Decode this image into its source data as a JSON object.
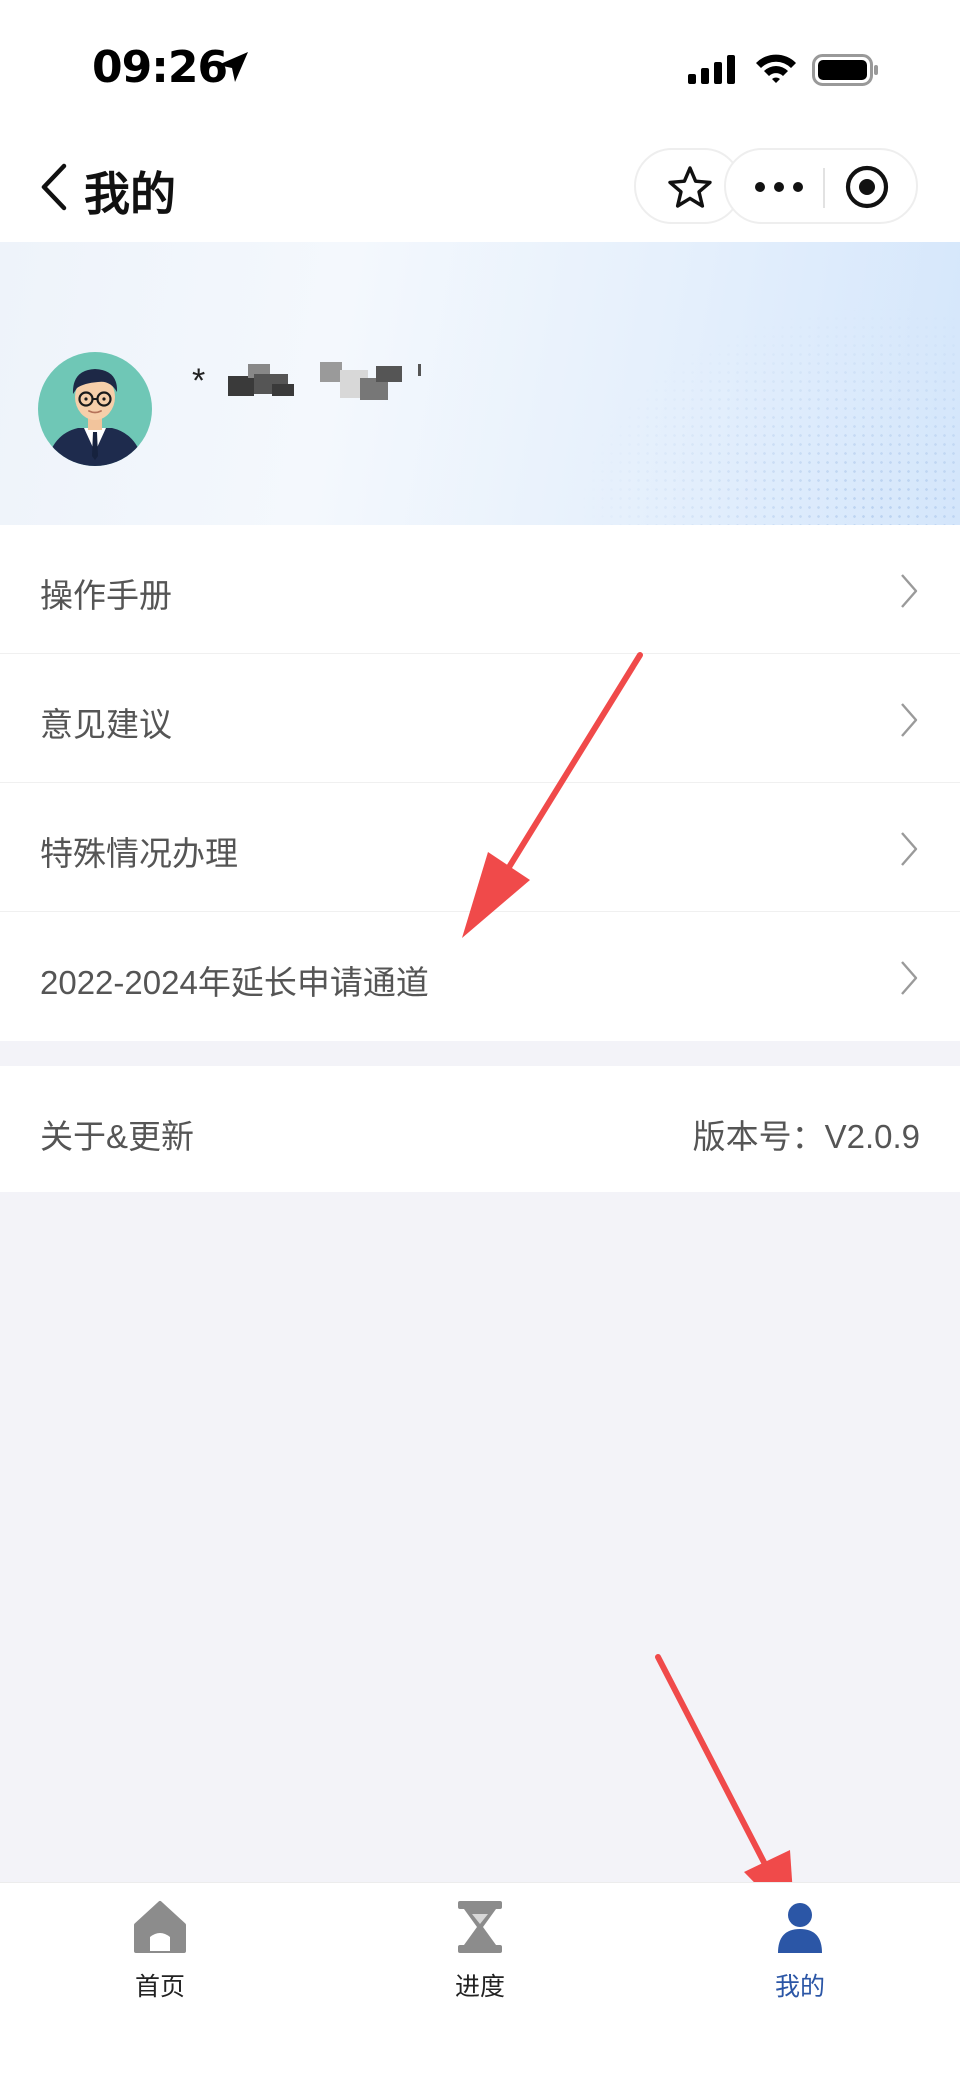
{
  "status_bar": {
    "time": "09:26"
  },
  "nav": {
    "title": "我的",
    "icons": [
      "back-icon",
      "star-icon",
      "more-icon",
      "target-icon"
    ]
  },
  "profile": {
    "name_prefix": "*"
  },
  "menu": {
    "items": [
      {
        "label": "操作手册"
      },
      {
        "label": "意见建议"
      },
      {
        "label": "特殊情况办理"
      },
      {
        "label": "2022-2024年延长申请通道"
      }
    ],
    "chevron_icon": "chevron-right-icon"
  },
  "about": {
    "label": "关于&更新",
    "version": "版本号：V2.0.9"
  },
  "tabs": [
    {
      "label": "首页",
      "icon": "home-icon",
      "active": false
    },
    {
      "label": "进度",
      "icon": "hourglass-icon",
      "active": false
    },
    {
      "label": "我的",
      "icon": "person-icon",
      "active": true
    }
  ],
  "colors": {
    "active_tab": "#2b56a6",
    "annotation_arrow": "#f04a4a"
  }
}
